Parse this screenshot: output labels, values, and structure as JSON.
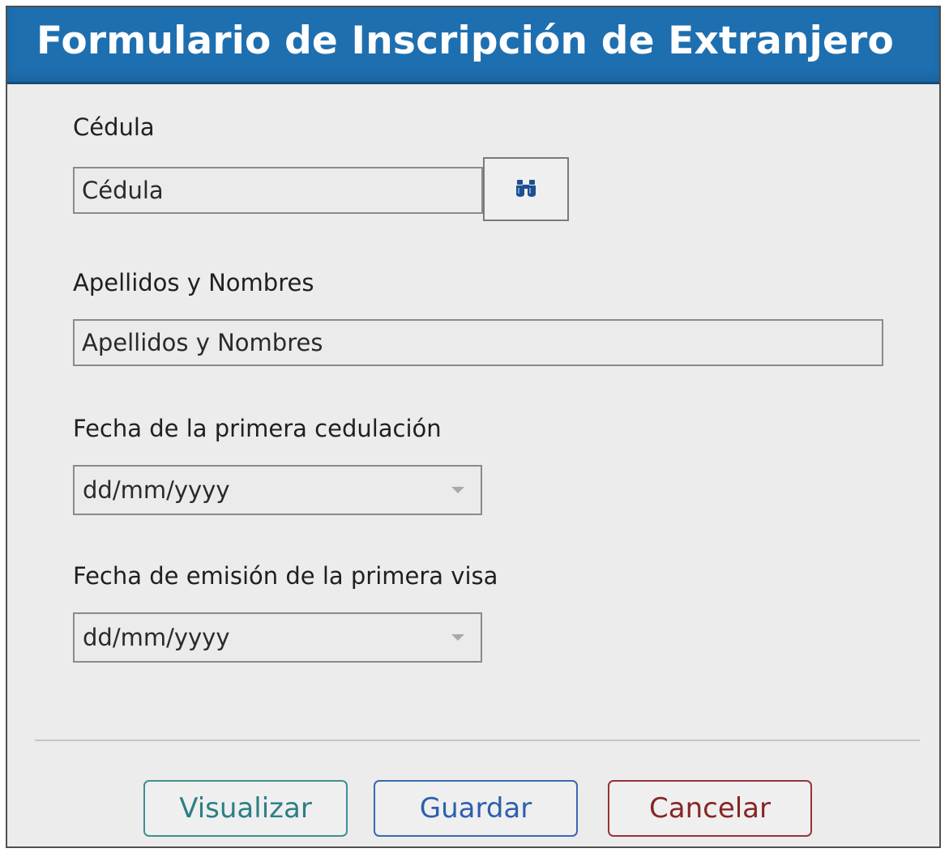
{
  "window": {
    "title": "Formulario de Inscripción de Extranjero"
  },
  "form": {
    "cedula": {
      "label": "Cédula",
      "placeholder": "Cédula",
      "value": "",
      "search_icon": "binoculars-icon"
    },
    "nombres": {
      "label": "Apellidos y Nombres",
      "placeholder": "Apellidos y Nombres",
      "value": ""
    },
    "fecha_cedulacion": {
      "label": "Fecha de la primera cedulación",
      "value": "dd/mm/yyyy",
      "icon": "chevron-down-icon"
    },
    "fecha_visa": {
      "label": "Fecha de emisión de la primera visa",
      "value": "dd/mm/yyyy",
      "icon": "chevron-down-icon"
    }
  },
  "actions": {
    "visualizar_label": "Visualizar",
    "guardar_label": "Guardar",
    "cancelar_label": "Cancelar"
  },
  "colors": {
    "title_bar": "#1e6fb0",
    "visualizar": "#2c7f84",
    "guardar": "#2c5fae",
    "cancelar": "#862526"
  }
}
